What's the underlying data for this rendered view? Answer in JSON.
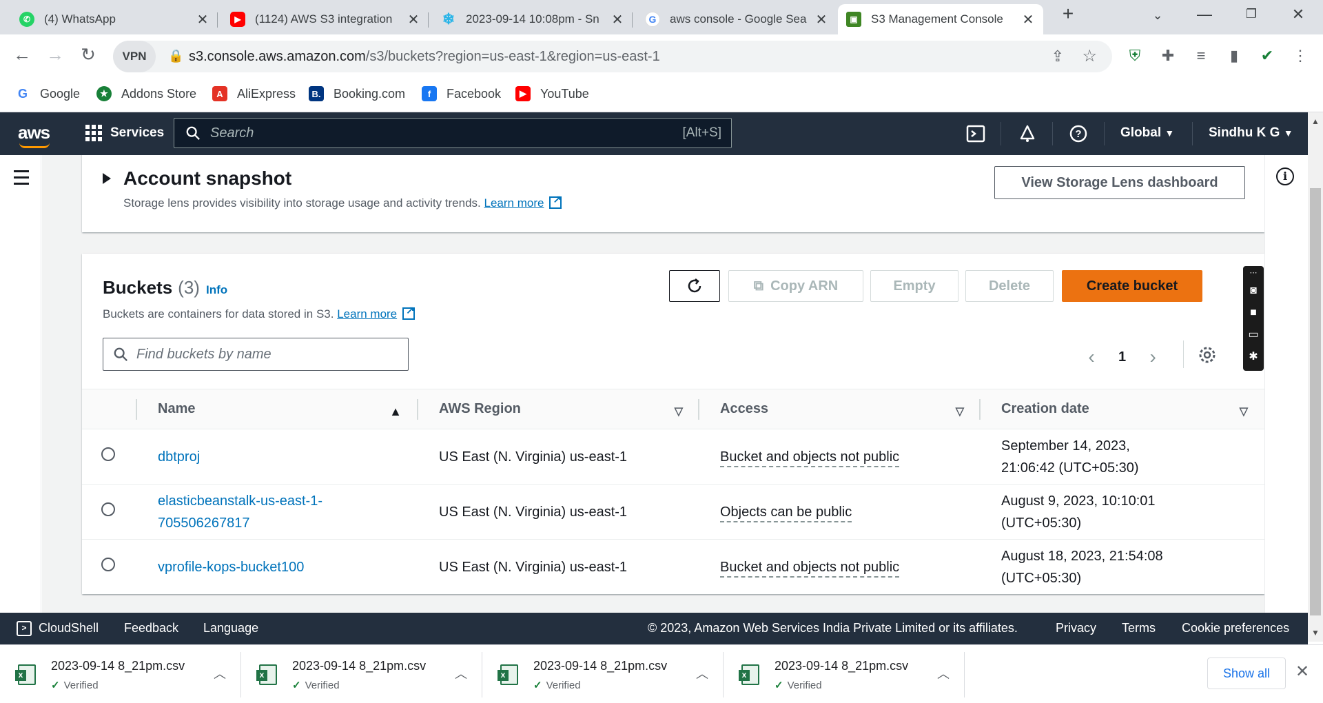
{
  "browser": {
    "tabs": [
      {
        "title": "(4) WhatsApp",
        "icon": "whatsapp-icon"
      },
      {
        "title": "(1124) AWS S3 integration",
        "icon": "youtube-icon"
      },
      {
        "title": "2023-09-14 10:08pm - Sn",
        "icon": "snowflake-icon"
      },
      {
        "title": "aws console - Google Sea",
        "icon": "google-icon"
      },
      {
        "title": "S3 Management Console",
        "icon": "s3-icon"
      }
    ],
    "vpn_label": "VPN",
    "url_host": "s3.console.aws.amazon.com",
    "url_path": "/s3/buckets?region=us-east-1&region=us-east-1",
    "bookmarks": [
      "Google",
      "Addons Store",
      "AliExpress",
      "Booking.com",
      "Facebook",
      "YouTube"
    ]
  },
  "aws_header": {
    "logo": "aws",
    "services": "Services",
    "search_placeholder": "Search",
    "search_shortcut": "[Alt+S]",
    "region": "Global",
    "user": "Sindhu K G"
  },
  "snapshot": {
    "title": "Account snapshot",
    "description": "Storage lens provides visibility into storage usage and activity trends.",
    "learn_more": "Learn more",
    "dashboard_button": "View Storage Lens dashboard"
  },
  "buckets": {
    "title": "Buckets",
    "count": "(3)",
    "info": "Info",
    "description": "Buckets are containers for data stored in S3.",
    "learn_more": "Learn more",
    "buttons": {
      "copy_arn": "Copy ARN",
      "empty": "Empty",
      "delete": "Delete",
      "create": "Create bucket"
    },
    "find_placeholder": "Find buckets by name",
    "page": "1",
    "columns": [
      "Name",
      "AWS Region",
      "Access",
      "Creation date"
    ],
    "rows": [
      {
        "name": "dbtproj",
        "region": "US East (N. Virginia) us-east-1",
        "access": "Bucket and objects not public",
        "created_1": "September 14, 2023,",
        "created_2": "21:06:42 (UTC+05:30)"
      },
      {
        "name": "elasticbeanstalk-us-east-1-",
        "name_2": "705506267817",
        "region": "US East (N. Virginia) us-east-1",
        "access": "Objects can be public",
        "created_1": "August 9, 2023, 10:10:01",
        "created_2": "(UTC+05:30)"
      },
      {
        "name": "vprofile-kops-bucket100",
        "region": "US East (N. Virginia) us-east-1",
        "access": "Bucket and objects not public",
        "created_1": "August 18, 2023, 21:54:08",
        "created_2": "(UTC+05:30)"
      }
    ]
  },
  "footer": {
    "cloudshell": "CloudShell",
    "feedback": "Feedback",
    "language": "Language",
    "copyright": "© 2023, Amazon Web Services India Private Limited or its affiliates.",
    "privacy": "Privacy",
    "terms": "Terms",
    "cookie": "Cookie preferences"
  },
  "downloads": {
    "items": [
      {
        "file": "2023-09-14 8_21pm.csv",
        "status": "Verified"
      },
      {
        "file": "2023-09-14 8_21pm.csv",
        "status": "Verified"
      },
      {
        "file": "2023-09-14 8_21pm.csv",
        "status": "Verified"
      },
      {
        "file": "2023-09-14 8_21pm.csv",
        "status": "Verified"
      }
    ],
    "show_all": "Show all"
  },
  "colors": {
    "aws_navy": "#232f3e",
    "aws_orange": "#ec7211",
    "link_blue": "#0073bb"
  }
}
